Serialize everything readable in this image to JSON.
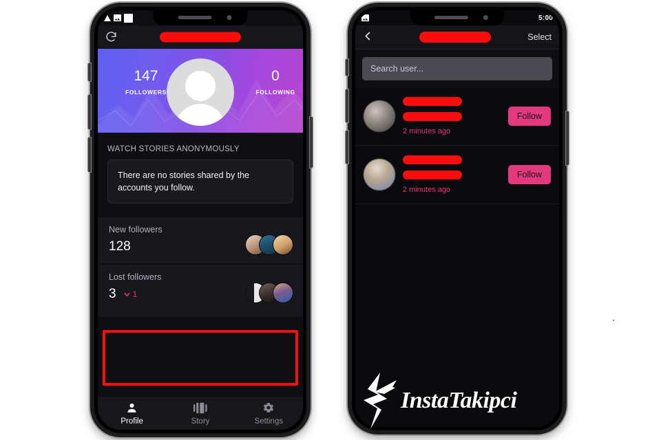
{
  "meta": {
    "accent_pink": "#e8366f",
    "redaction_red": "#fb0d0d",
    "highlight_red": "#fb0d0d",
    "follow_button_bg": "#e23a7d"
  },
  "left_phone": {
    "status_bar": {
      "icons": [
        "signal-triangle-icon",
        "image-icon",
        "white-square-icon"
      ],
      "time": ""
    },
    "nav": {
      "refresh_icon": "refresh-icon",
      "title_redacted": true,
      "title": ""
    },
    "hero": {
      "followers_value": "147",
      "followers_label": "FOLLOWERS",
      "following_value": "0",
      "following_label": "FOLLOWING",
      "avatar": "default-person-avatar"
    },
    "stories": {
      "section_title": "WATCH STORIES ANONYMOUSLY",
      "empty_message": "There are no stories shared by the accounts you follow."
    },
    "new_followers": {
      "label": "New followers",
      "value": "128",
      "thumbnails": 3
    },
    "lost_followers": {
      "label": "Lost followers",
      "value": "3",
      "delta": "1",
      "delta_icon": "chevron-down-icon",
      "thumbnails": 3,
      "highlighted": true
    },
    "tabs": [
      {
        "label": "Profile",
        "icon": "person-icon",
        "active": true
      },
      {
        "label": "Story",
        "icon": "story-icon",
        "active": false
      },
      {
        "label": "Settings",
        "icon": "gear-icon",
        "active": false
      }
    ]
  },
  "right_phone": {
    "status_bar": {
      "icons": [
        "image-icon"
      ],
      "time": "5:00"
    },
    "nav": {
      "back_icon": "chevron-left-icon",
      "title_redacted": true,
      "title": "",
      "select_label": "Select"
    },
    "search": {
      "placeholder": "Search user...",
      "value": ""
    },
    "users": [
      {
        "name_redacted": true,
        "name": "",
        "handle_redacted": true,
        "handle": "",
        "time": "2 minutes ago",
        "action_label": "Follow"
      },
      {
        "name_redacted": true,
        "name": "",
        "handle_redacted": true,
        "handle": "",
        "time": "2 minutes ago",
        "action_label": "Follow"
      }
    ]
  },
  "watermark": {
    "text": "InstaTakipci",
    "logo": "instatakipci-star-logo"
  }
}
